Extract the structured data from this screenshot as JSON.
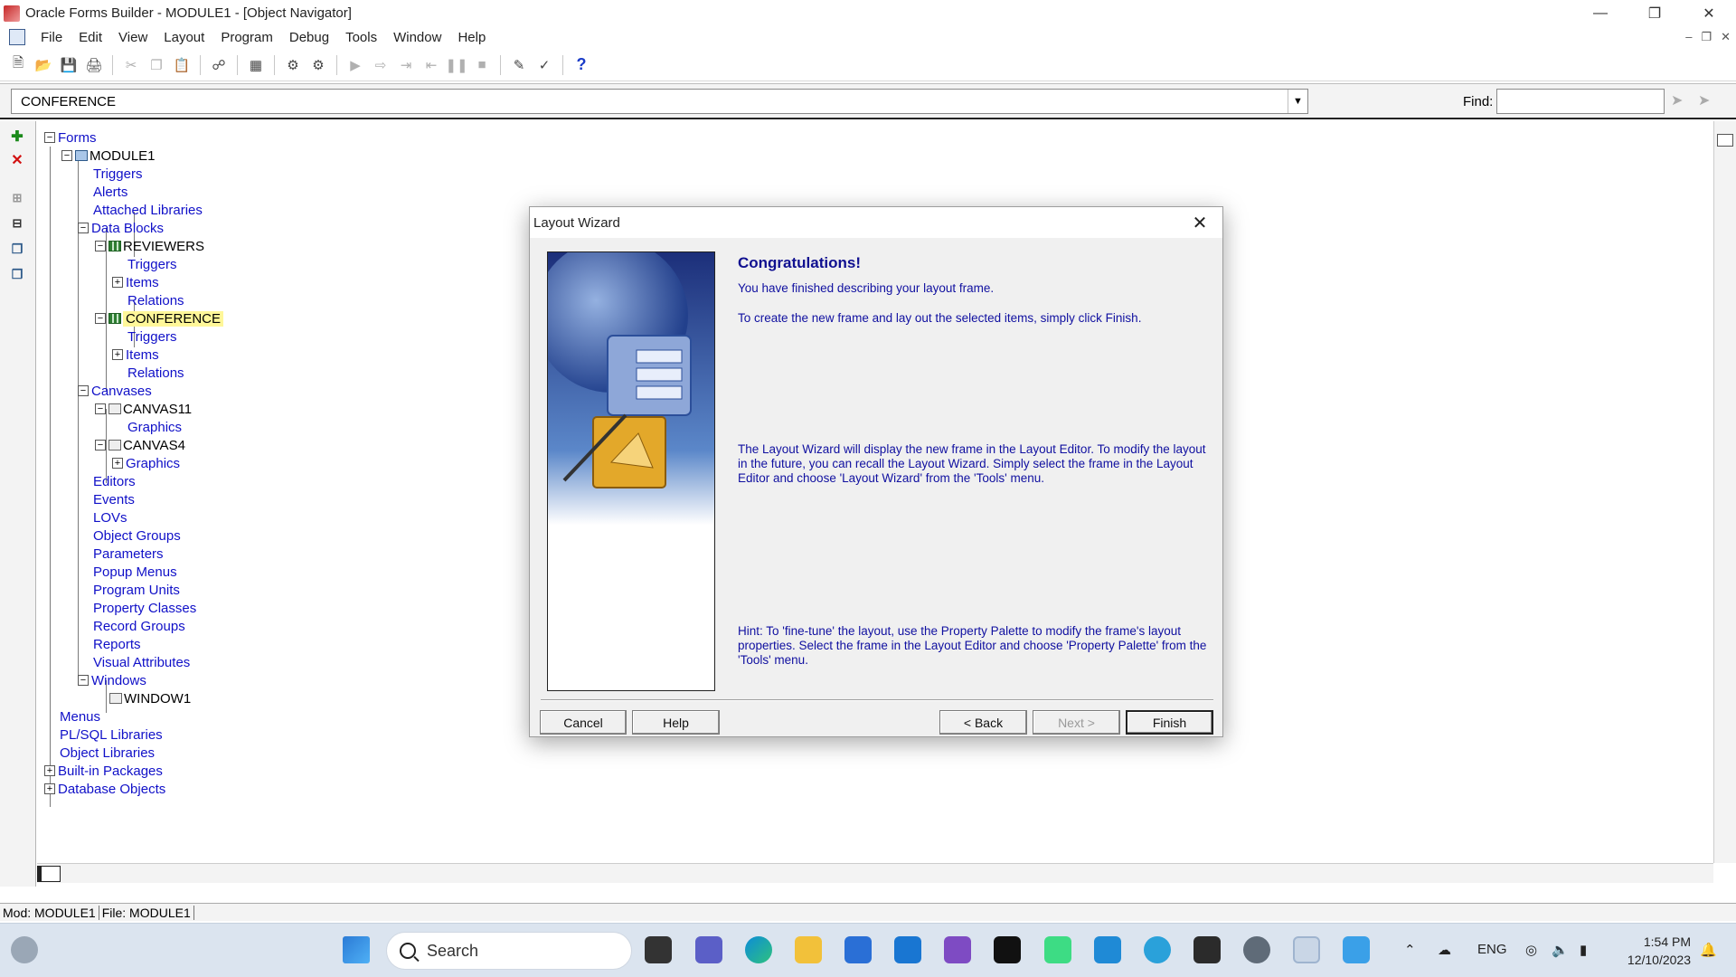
{
  "window": {
    "title": "Oracle Forms Builder - MODULE1 - [Object Navigator]"
  },
  "menu": [
    "File",
    "Edit",
    "View",
    "Layout",
    "Program",
    "Debug",
    "Tools",
    "Window",
    "Help"
  ],
  "context": {
    "selected": "CONFERENCE",
    "find_label": "Find:"
  },
  "tree": {
    "forms": "Forms",
    "module": "MODULE1",
    "triggers": "Triggers",
    "alerts": "Alerts",
    "attached_libraries": "Attached Libraries",
    "data_blocks": "Data Blocks",
    "reviewers": "REVIEWERS",
    "reviewers_triggers": "Triggers",
    "reviewers_items": "Items",
    "reviewers_relations": "Relations",
    "conference": "CONFERENCE",
    "conference_triggers": "Triggers",
    "conference_items": "Items",
    "conference_relations": "Relations",
    "canvases": "Canvases",
    "canvas11": "CANVAS11",
    "canvas11_graphics": "Graphics",
    "canvas4": "CANVAS4",
    "canvas4_graphics": "Graphics",
    "editors": "Editors",
    "events": "Events",
    "lovs": "LOVs",
    "object_groups": "Object Groups",
    "parameters": "Parameters",
    "popup_menus": "Popup Menus",
    "program_units": "Program Units",
    "property_classes": "Property Classes",
    "record_groups": "Record Groups",
    "reports": "Reports",
    "visual_attributes": "Visual Attributes",
    "windows": "Windows",
    "window1": "WINDOW1",
    "menus": "Menus",
    "plsql_libraries": "PL/SQL Libraries",
    "object_libraries": "Object Libraries",
    "builtin_packages": "Built-in Packages",
    "database_objects": "Database Objects"
  },
  "status": {
    "module": "Mod: MODULE1",
    "file": "File: MODULE1"
  },
  "dialog": {
    "title": "Layout Wizard",
    "heading": "Congratulations!",
    "line1": "You have finished describing your layout frame.",
    "line2": "To create the new frame and lay out the selected items, simply click Finish.",
    "para": "The Layout Wizard will display the new frame in the Layout Editor. To modify the layout in the future, you can recall the Layout Wizard. Simply select the frame in the Layout Editor and choose 'Layout Wizard' from the 'Tools' menu.",
    "hint": "Hint: To 'fine-tune' the layout, use the Property Palette to modify the frame's layout properties. Select the frame in the Layout Editor and choose 'Property Palette' from the 'Tools' menu.",
    "buttons": {
      "cancel": "Cancel",
      "help": "Help",
      "back": "< Back",
      "next": "Next >",
      "finish": "Finish"
    }
  },
  "taskbar": {
    "search": "Search",
    "lang": "ENG",
    "time": "1:54 PM",
    "date": "12/10/2023"
  }
}
